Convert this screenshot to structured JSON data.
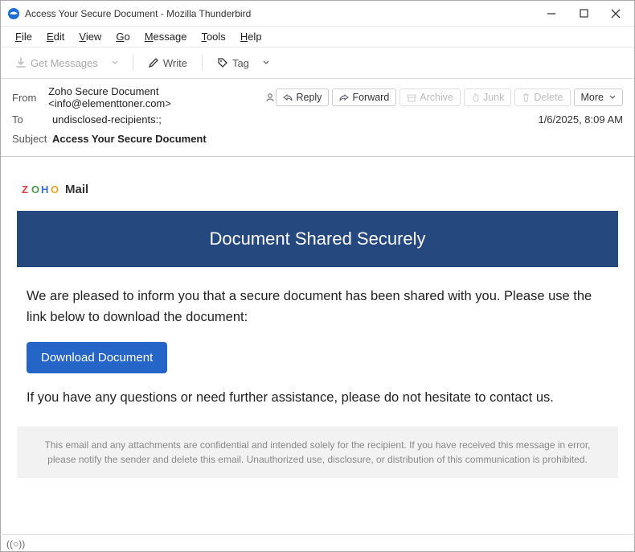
{
  "window": {
    "title": "Access Your Secure Document - Mozilla Thunderbird"
  },
  "menu": {
    "file": "File",
    "edit": "Edit",
    "view": "View",
    "go": "Go",
    "message": "Message",
    "tools": "Tools",
    "help": "Help"
  },
  "toolbar": {
    "get_messages": "Get Messages",
    "write": "Write",
    "tag": "Tag"
  },
  "header": {
    "from_label": "From",
    "from_value": "Zoho Secure Document <info@elementtoner.com>",
    "to_label": "To",
    "to_value": "undisclosed-recipients:;",
    "subject_label": "Subject",
    "subject_value": "Access Your Secure Document",
    "date": "1/6/2025, 8:09 AM"
  },
  "actions": {
    "reply": "Reply",
    "forward": "Forward",
    "archive": "Archive",
    "junk": "Junk",
    "delete": "Delete",
    "more": "More"
  },
  "email": {
    "logo_text": "Mail",
    "banner": "Document Shared Securely",
    "p1": "We are pleased to inform you that a secure document has been shared with you. Please use the link below to download the document:",
    "button": "Download Document",
    "p2": "If you have any questions or need further assistance, please do not hesitate to contact us.",
    "footer": "This email and any attachments are confidential and intended solely for the recipient. If you have received this message in error, please notify the sender and delete this email. Unauthorized use, disclosure, or distribution of this communication is prohibited."
  },
  "status": {
    "indicator": "((○))"
  }
}
